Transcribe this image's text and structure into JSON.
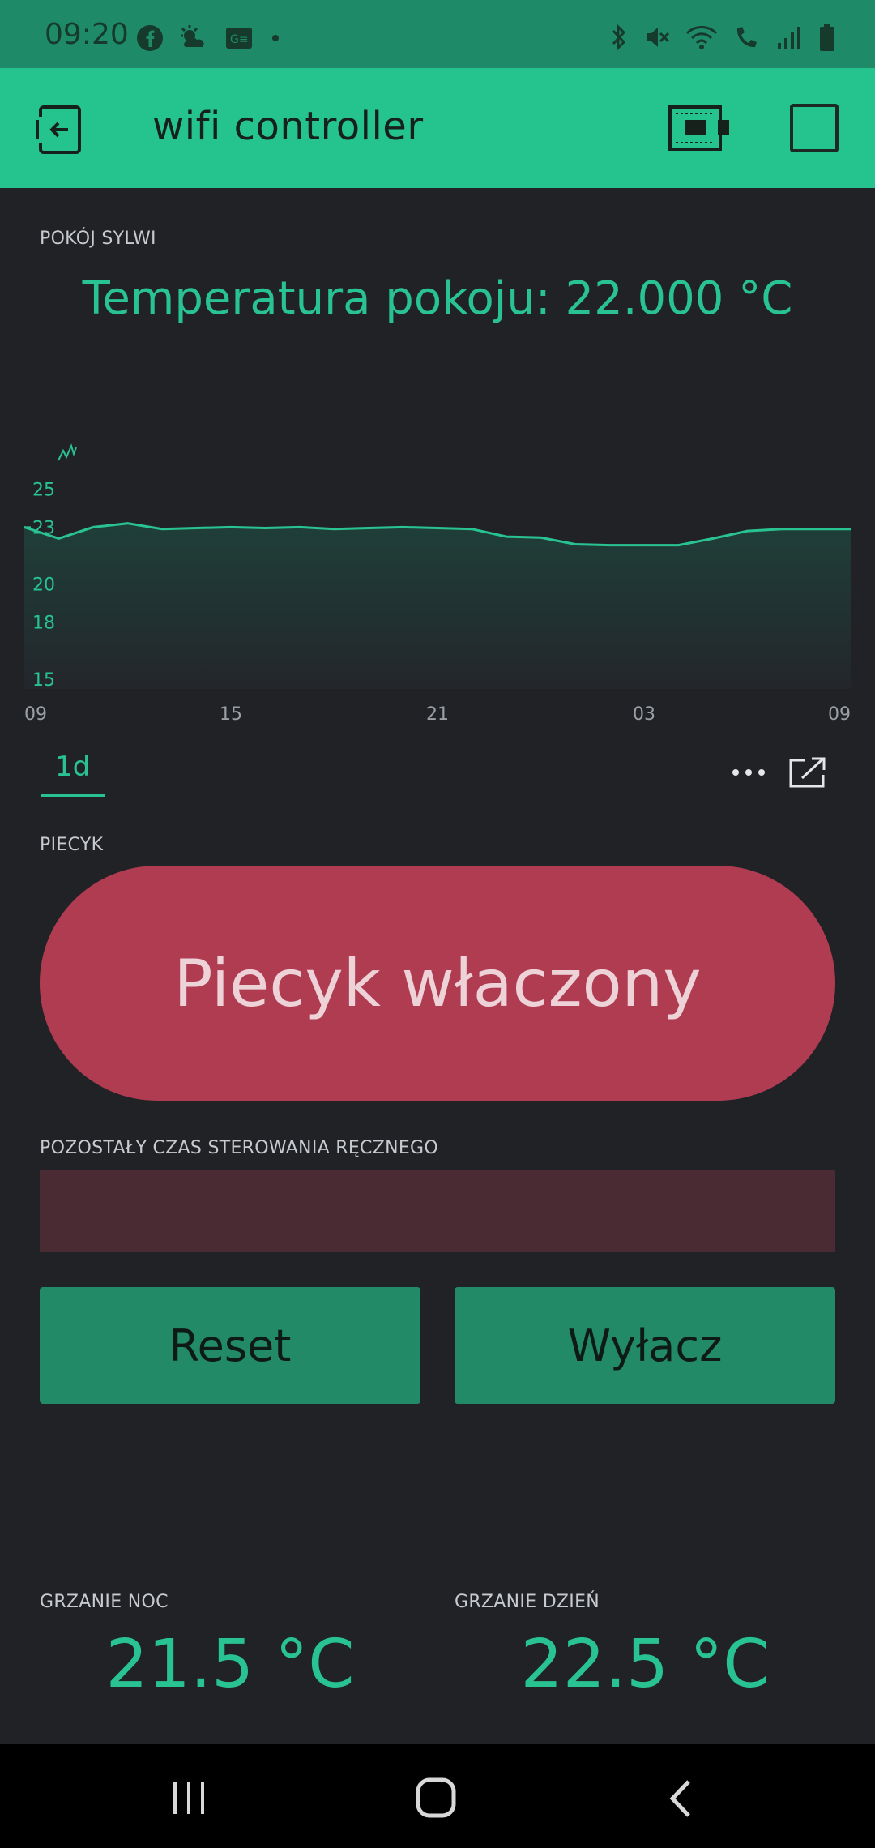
{
  "status_bar": {
    "time": "09:20",
    "left_icons": [
      "facebook-icon",
      "weather-icon",
      "news-icon",
      "dot-icon"
    ],
    "right_icons": [
      "bluetooth-icon",
      "mute-icon",
      "wifi-icon",
      "wifi-call-icon",
      "signal-icon",
      "battery-icon"
    ]
  },
  "app_bar": {
    "title": "wifi controller",
    "back_icon": "exit-icon",
    "device_icon": "device-icon",
    "stop_icon": "square-icon"
  },
  "temperature_section": {
    "label": "POKÓJ SYLWI",
    "value_text": "Temperatura pokoju: 22.000 °C"
  },
  "chart_data": {
    "type": "area",
    "x_tick_labels": [
      "09",
      "15",
      "21",
      "03",
      "09"
    ],
    "y_tick_labels": [
      "25",
      "23",
      "20",
      "18",
      "15"
    ],
    "ylim": [
      15,
      26
    ],
    "x": [
      0,
      1,
      2,
      3,
      4,
      5,
      6,
      7,
      8,
      9,
      10,
      11,
      12,
      13,
      14,
      15,
      16,
      17,
      18,
      19,
      20,
      21,
      22,
      23,
      24
    ],
    "values": [
      23.0,
      22.4,
      23.0,
      23.2,
      22.9,
      22.95,
      23.0,
      22.95,
      23.0,
      22.9,
      22.95,
      23.0,
      22.95,
      22.9,
      22.5,
      22.45,
      22.1,
      22.05,
      22.05,
      22.05,
      22.4,
      22.8,
      22.9,
      22.9,
      22.9
    ],
    "color": "#29c391",
    "range_tab": "1d"
  },
  "heater": {
    "label": "PIECYK",
    "button_text": "Piecyk właczony",
    "color": "#b03c52"
  },
  "manual_control": {
    "label": "POZOSTAŁY CZAS STEROWANIA RĘCZNEGO"
  },
  "buttons": {
    "reset": "Reset",
    "off": "Wyłacz"
  },
  "heating": {
    "night_label": "GRZANIE NOC",
    "night_value": "21.5 °C",
    "day_label": "GRZANIE DZIEŃ",
    "day_value": "22.5 °C"
  },
  "nav_bar": {
    "icons": [
      "recent-apps-icon",
      "home-icon",
      "back-icon"
    ]
  },
  "colors": {
    "accent": "#29c391",
    "app_bar": "#25c48f",
    "status_bar": "#1f8a68",
    "background": "#212226"
  }
}
